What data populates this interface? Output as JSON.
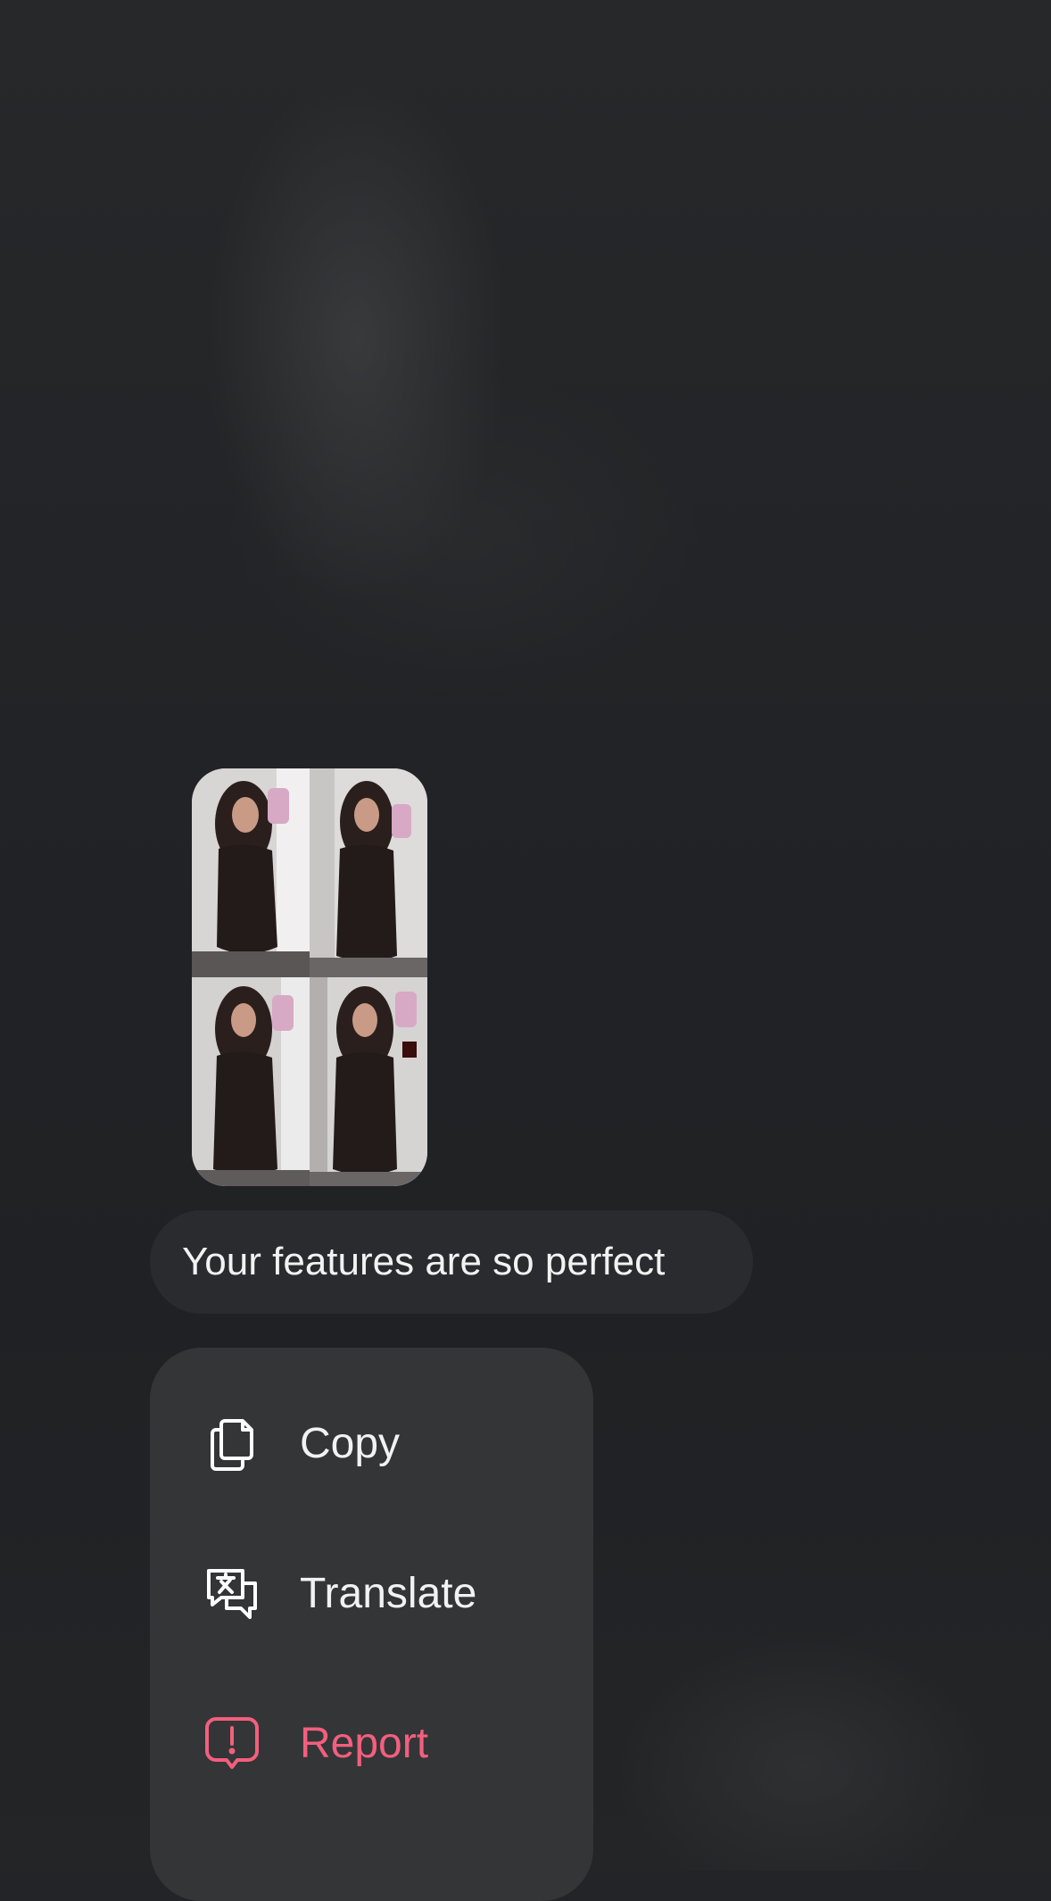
{
  "message": {
    "text": "Your features are so perfect",
    "attachment": {
      "photo_count": 4
    }
  },
  "context_menu": {
    "items": [
      {
        "id": "copy",
        "label": "Copy",
        "icon": "copy-icon"
      },
      {
        "id": "translate",
        "label": "Translate",
        "icon": "translate-icon"
      },
      {
        "id": "report",
        "label": "Report",
        "icon": "report-icon",
        "color": "#f35f7e"
      }
    ]
  },
  "colors": {
    "background": "#222427",
    "menu_background": "#333537",
    "bubble_background": "#292b2f",
    "text": "#f2f2f2",
    "danger": "#f35f7e"
  }
}
